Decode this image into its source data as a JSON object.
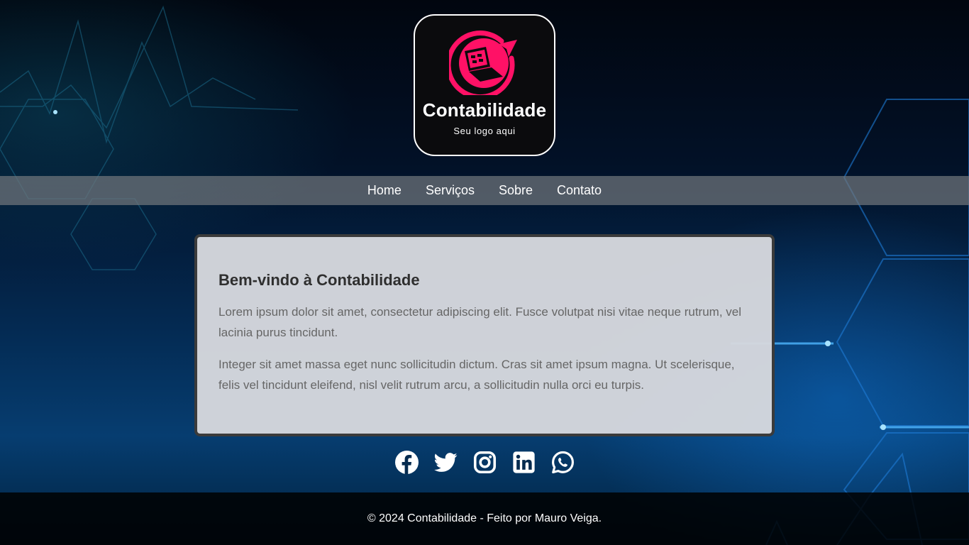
{
  "logo": {
    "name": "Contabilidade",
    "tagline": "Seu logo aqui",
    "accent": "#ff1166"
  },
  "nav": {
    "items": [
      {
        "label": "Home"
      },
      {
        "label": "Serviços"
      },
      {
        "label": "Sobre"
      },
      {
        "label": "Contato"
      }
    ]
  },
  "content": {
    "title": "Bem-vindo à Contabilidade",
    "paragraphs": [
      "Lorem ipsum dolor sit amet, consectetur adipiscing elit. Fusce volutpat nisi vitae neque rutrum, vel lacinia purus tincidunt.",
      "Integer sit amet massa eget nunc sollicitudin dictum. Cras sit amet ipsum magna. Ut scelerisque, felis vel tincidunt eleifend, nisl velit rutrum arcu, a sollicitudin nulla orci eu turpis."
    ]
  },
  "social": {
    "icons": [
      "facebook-icon",
      "twitter-icon",
      "instagram-icon",
      "linkedin-icon",
      "whatsapp-icon"
    ]
  },
  "footer": {
    "text": "© 2024 Contabilidade - Feito por Mauro Veiga."
  }
}
